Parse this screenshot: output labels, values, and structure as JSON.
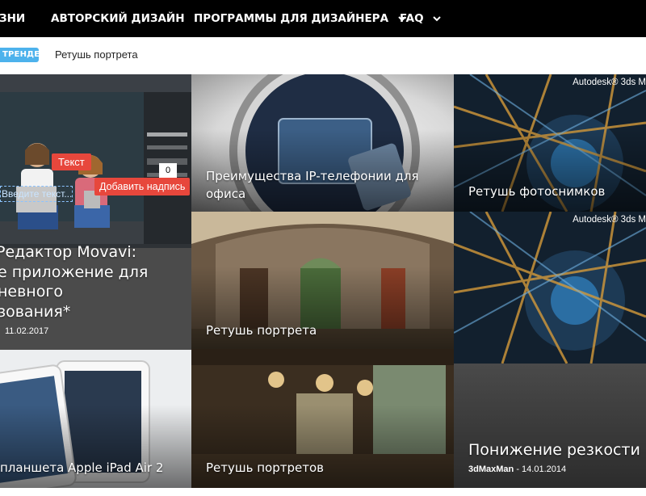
{
  "nav": {
    "items": [
      {
        "label": "ЗНИ",
        "has_caret": false
      },
      {
        "label": "АВТОРСКИЙ ДИЗАЙН",
        "has_caret": false
      },
      {
        "label": "ПРОГРАММЫ ДЛЯ ДИЗАЙНЕРА",
        "has_caret": true
      },
      {
        "label": "FAQ",
        "has_caret": true
      }
    ]
  },
  "trending": {
    "badge": "ТРЕНДЕ",
    "link": "Ретушь портрета",
    "badge_color": "#4db2ec"
  },
  "tiles": {
    "movavi": {
      "title_lines": [
        "Редактор Movavi:",
        "е приложение для",
        "невного",
        "зования*"
      ],
      "date": "11.02.2017",
      "text_tag": "Текст",
      "add_button": "Добавить надпись",
      "input_placeholder": "Введите текст...",
      "counter": "0"
    },
    "ip": {
      "title_lines": [
        "Преимущества IP-телефонии для",
        "офиса"
      ]
    },
    "foto": {
      "title": "Ретушь фотоснимков",
      "brand": "Autodesk® 3ds M"
    },
    "portrait": {
      "title": "Ретушь портрета"
    },
    "sharp": {
      "title": "Понижение резкости",
      "author": "3dMaxMan",
      "separator": "-",
      "date": "14.01.2014",
      "brand": "Autodesk® 3ds M"
    },
    "ipad": {
      "title": "планшета Apple iPad Air 2"
    },
    "portraits": {
      "title": "Ретушь портретов"
    }
  },
  "colors": {
    "nav_bg": "#000000",
    "accent_red": "#e7473c"
  }
}
